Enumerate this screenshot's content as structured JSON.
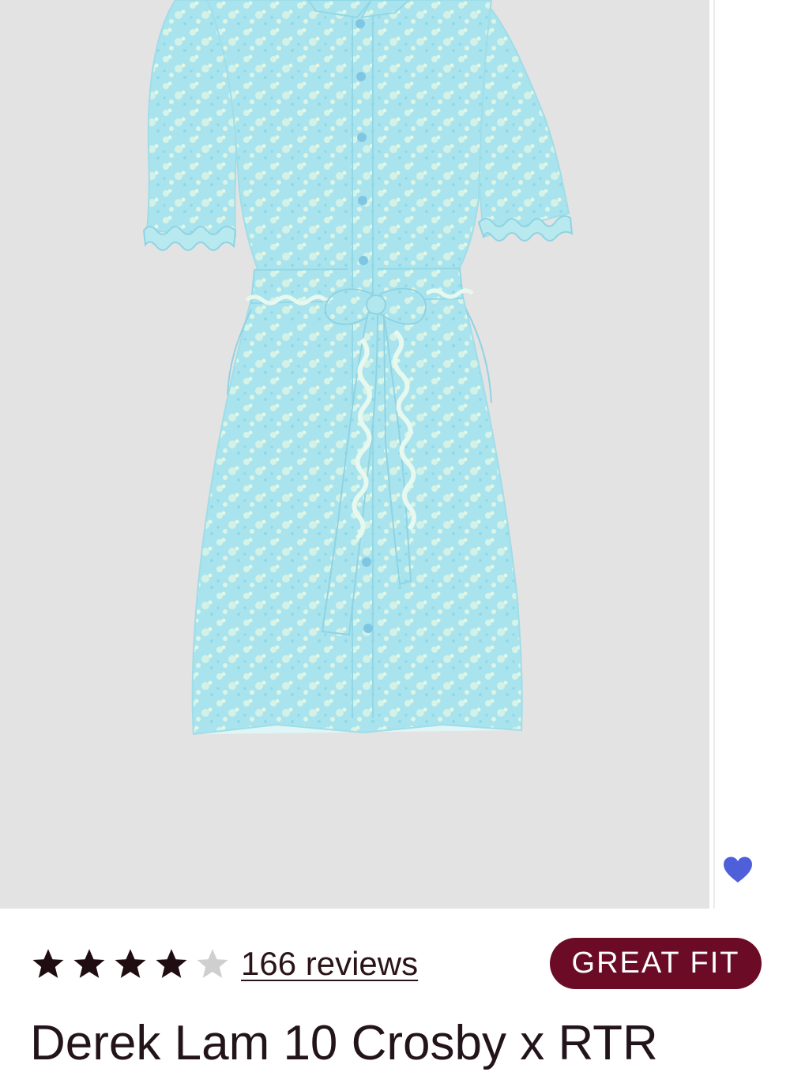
{
  "product": {
    "title": "Derek Lam 10 Crosby x RTR",
    "image_alt": "Light blue floral print short-sleeve shirt dress with ruffle trim and tie belt",
    "favorite_icon": "heart-icon",
    "favorite_color": "#4f5fd9"
  },
  "rating": {
    "value": 4,
    "max": 5,
    "star_color": "#1f0d12",
    "empty_star_color": "#cfcfcf",
    "reviews_label": "166 reviews"
  },
  "fit_badge": {
    "label": "GREAT FIT",
    "color": "#6b0b26"
  }
}
